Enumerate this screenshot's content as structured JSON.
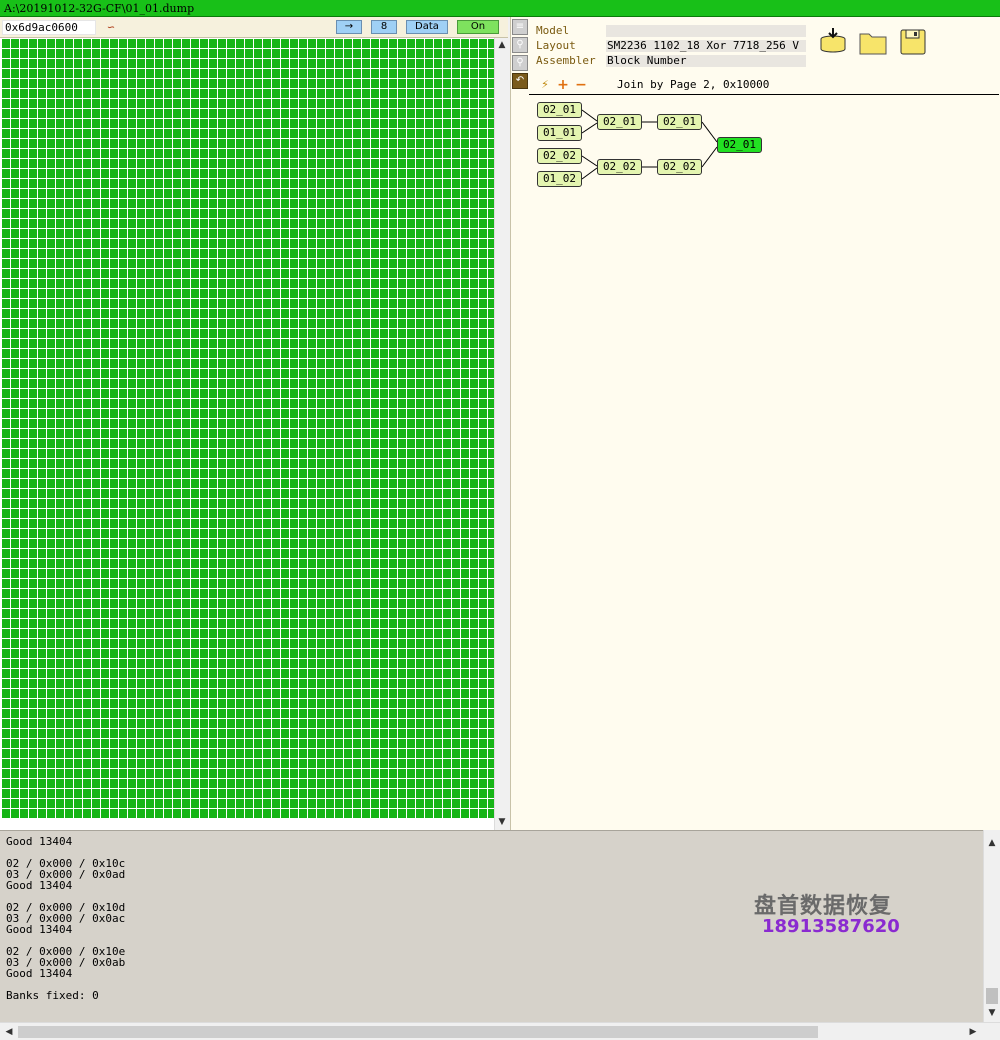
{
  "window": {
    "title": "A:\\20191012-32G-CF\\01_01.dump"
  },
  "toolbar": {
    "address": "0x6d9ac0600",
    "link_icon": "link-icon",
    "arrow_label": "→",
    "value_label": "8",
    "data_label": "Data",
    "on_label": "On"
  },
  "scroll": {
    "up": "▲",
    "down": "▼",
    "left": "◀",
    "right": "▶"
  },
  "props": {
    "model_label": "Model",
    "model_value": "",
    "layout_label": "Layout",
    "layout_value": "SM2236 1102_18 Xor 7718_256 V",
    "assembler_label": "Assembler",
    "assembler_value": "Block Number"
  },
  "assembler": {
    "bolt_icon": "⚡",
    "plus_icon": "+",
    "minus_icon": "−",
    "join_text": "Join by Page 2, 0x10000"
  },
  "tree_nodes": [
    "02_01",
    "01_01",
    "02_02",
    "01_02",
    "02_01",
    "02_02",
    "02_01",
    "02_02",
    "02_01"
  ],
  "log_lines": [
    "Good 13404",
    "",
    "02 / 0x000 / 0x10c",
    "03 / 0x000 / 0x0ad",
    "Good 13404",
    "",
    "02 / 0x000 / 0x10d",
    "03 / 0x000 / 0x0ac",
    "Good 13404",
    "",
    "02 / 0x000 / 0x10e",
    "03 / 0x000 / 0x0ab",
    "Good 13404",
    "",
    "Banks fixed: 0"
  ],
  "watermark": {
    "name": "盘首数据恢复",
    "phone": "18913587620"
  },
  "colors": {
    "title_bar": "#18c018",
    "grid_fill": "#16b516",
    "grid_line": "#ffffff",
    "node_fill": "#e4f5b0",
    "root_node_fill": "#22e022",
    "log_bg": "#d6d2ca"
  }
}
